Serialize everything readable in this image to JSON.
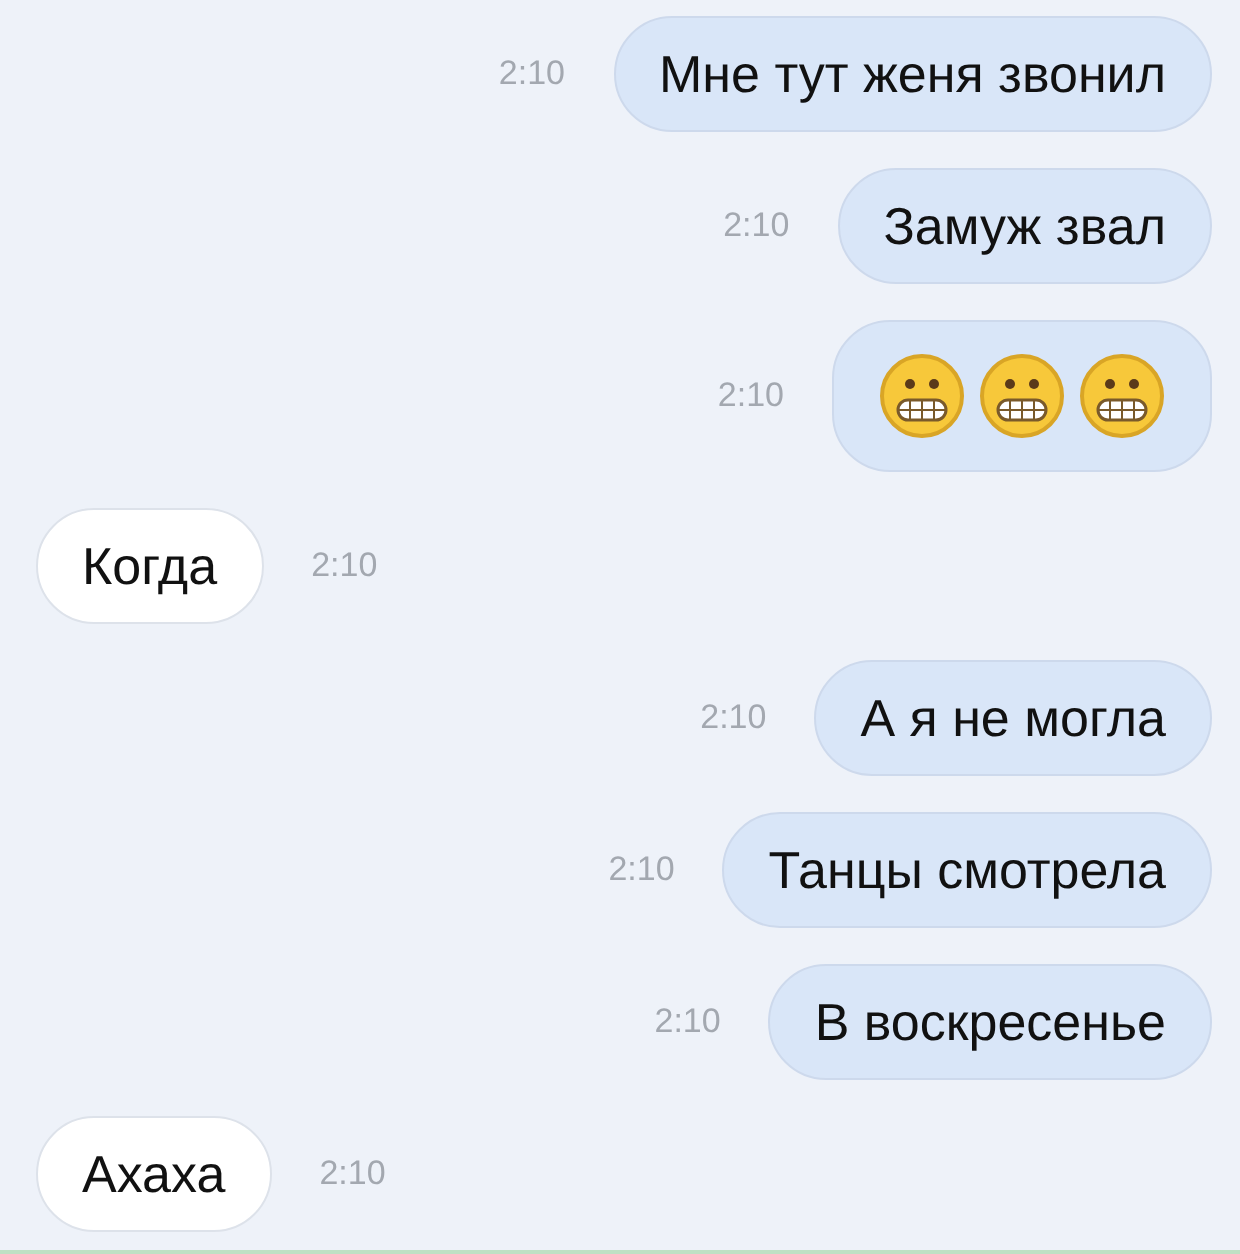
{
  "messages": [
    {
      "kind": "text",
      "outgoing": true,
      "text": "Мне тут женя звонил",
      "time": "2:10"
    },
    {
      "kind": "text",
      "outgoing": true,
      "text": "Замуж звал",
      "time": "2:10"
    },
    {
      "kind": "emoji",
      "outgoing": true,
      "time": "2:10"
    },
    {
      "kind": "text",
      "outgoing": false,
      "text": "Когда",
      "time": "2:10"
    },
    {
      "kind": "text",
      "outgoing": true,
      "text": "А я не могла",
      "time": "2:10"
    },
    {
      "kind": "text",
      "outgoing": true,
      "text": "Танцы смотрела",
      "time": "2:10"
    },
    {
      "kind": "text",
      "outgoing": true,
      "text": "В воскресенье",
      "time": "2:10"
    },
    {
      "kind": "text",
      "outgoing": false,
      "text": "Ахаха",
      "time": "2:10"
    }
  ]
}
